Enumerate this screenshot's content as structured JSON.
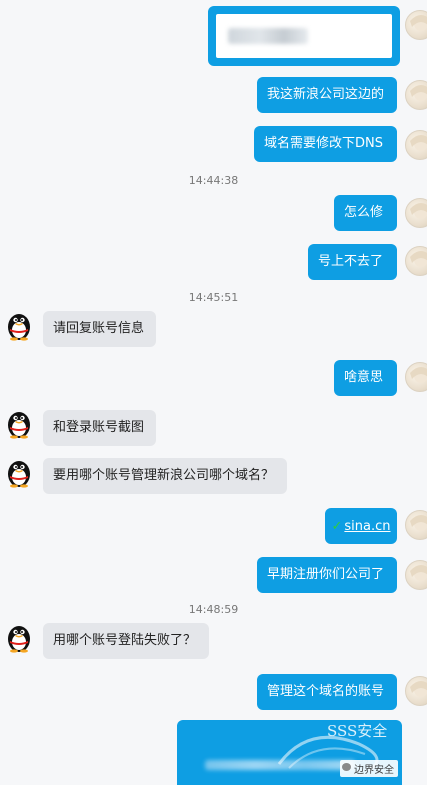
{
  "messages": {
    "m1": "我这新浪公司这边的",
    "m2": "域名需要修改下DNS",
    "m3": "怎么修",
    "m4": "号上不去了",
    "m5": "请回复账号信息",
    "m6": "啥意思",
    "m7": "和登录账号截图",
    "m8": "要用哪个账号管理新浪公司哪个域名？",
    "m9_link": "sina.cn",
    "m10": "早期注册你们公司了",
    "m11": "用哪个账号登陆失败了？",
    "m12": "管理这个域名的账号"
  },
  "timestamps": {
    "t1": "14:44:38",
    "t2": "14:45:51",
    "t3": "14:48:59"
  },
  "watermark": {
    "sss": "SSS安全",
    "brand": "边界安全"
  },
  "colors": {
    "outgoing": "#0e9ee3",
    "incoming": "#e4e6ea",
    "link_check": "#2ecc40"
  },
  "icons": {
    "peer_avatar": "qq-penguin-icon",
    "my_avatar": "anime-avatar-icon",
    "link_check": "check-icon"
  }
}
